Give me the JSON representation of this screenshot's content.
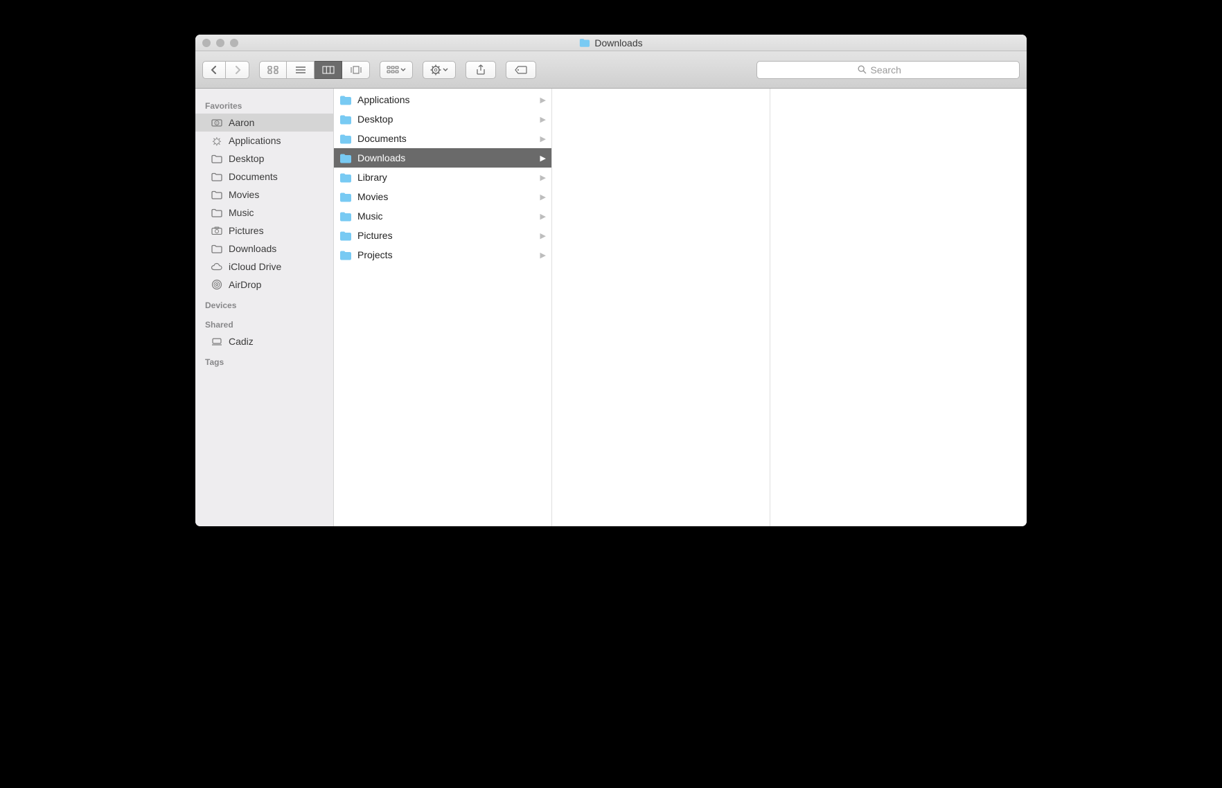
{
  "window": {
    "title": "Downloads"
  },
  "search": {
    "placeholder": "Search"
  },
  "sidebar": {
    "sections": {
      "favorites": {
        "label": "Favorites",
        "items": [
          {
            "icon": "hdd",
            "label": "Aaron",
            "selected": true
          },
          {
            "icon": "apps",
            "label": "Applications"
          },
          {
            "icon": "folder",
            "label": "Desktop"
          },
          {
            "icon": "folder",
            "label": "Documents"
          },
          {
            "icon": "folder",
            "label": "Movies"
          },
          {
            "icon": "folder",
            "label": "Music"
          },
          {
            "icon": "camera",
            "label": "Pictures"
          },
          {
            "icon": "folder",
            "label": "Downloads"
          },
          {
            "icon": "cloud",
            "label": "iCloud Drive"
          },
          {
            "icon": "airdrop",
            "label": "AirDrop"
          }
        ]
      },
      "devices": {
        "label": "Devices"
      },
      "shared": {
        "label": "Shared",
        "items": [
          {
            "icon": "computer",
            "label": "Cadiz"
          }
        ]
      },
      "tags": {
        "label": "Tags"
      }
    }
  },
  "column1": [
    {
      "label": "Applications",
      "selected": false
    },
    {
      "label": "Desktop",
      "selected": false
    },
    {
      "label": "Documents",
      "selected": false
    },
    {
      "label": "Downloads",
      "selected": true
    },
    {
      "label": "Library",
      "selected": false
    },
    {
      "label": "Movies",
      "selected": false
    },
    {
      "label": "Music",
      "selected": false
    },
    {
      "label": "Pictures",
      "selected": false
    },
    {
      "label": "Projects",
      "selected": false
    }
  ]
}
